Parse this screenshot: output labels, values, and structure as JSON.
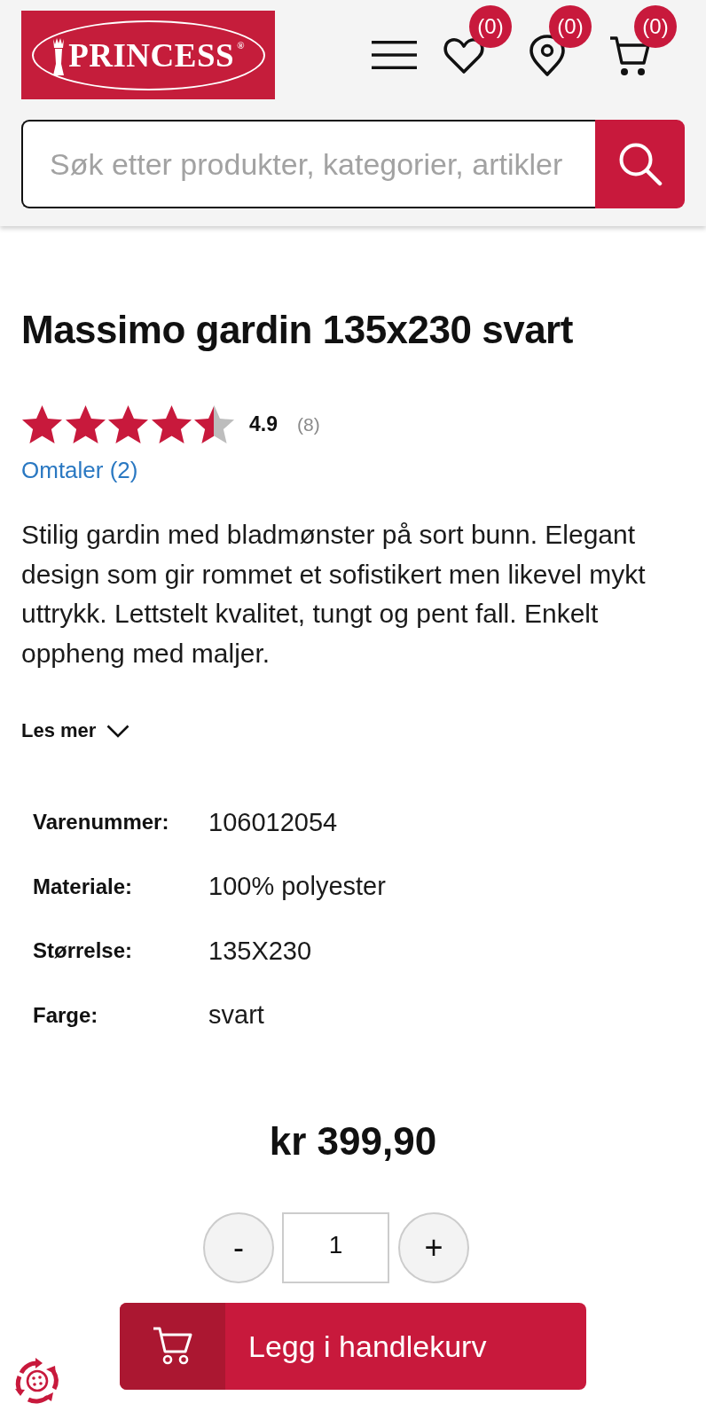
{
  "header": {
    "logo": {
      "text": "PRINCESS$^{®}$"
    },
    "nav": [
      {
        "kind": "menu"
      },
      {
        "kind": "wishlist",
        "badge": "(0)"
      },
      {
        "kind": "store",
        "badge": "(0)"
      },
      {
        "kind": "cart",
        "badge": "(0)"
      }
    ],
    "search": {
      "placeholder": "Søk etter produkter, kategorier, artikler"
    }
  },
  "product": {
    "title": "Massimo gardin 135x230 svart",
    "rating": {
      "stars": 4.5,
      "score": "4.9",
      "count": "(8)"
    },
    "reviews_link": "Omtaler (2)",
    "description": "Stilig gardin med bladmønster på sort bunn. Elegant design som gir rommet et sofistikert men likevel mykt uttrykk. Lettstelt kvalitet, tungt og pent fall. Enkelt oppheng med maljer.",
    "read_more": {
      "label": "Les mer",
      "expanded": false
    },
    "specs": [
      {
        "label": "Varenummer:",
        "value": "106012054"
      },
      {
        "label": "Materiale:",
        "value": "100% polyester"
      },
      {
        "label": "Størrelse:",
        "value": "135X230"
      },
      {
        "label": "Farge:",
        "value": "svart"
      }
    ],
    "price": "kr 399,90",
    "quantity": {
      "decrease": "-",
      "value": "1",
      "increase": "+"
    },
    "add_to_cart": {
      "label": "Legg i handlekurv"
    }
  }
}
